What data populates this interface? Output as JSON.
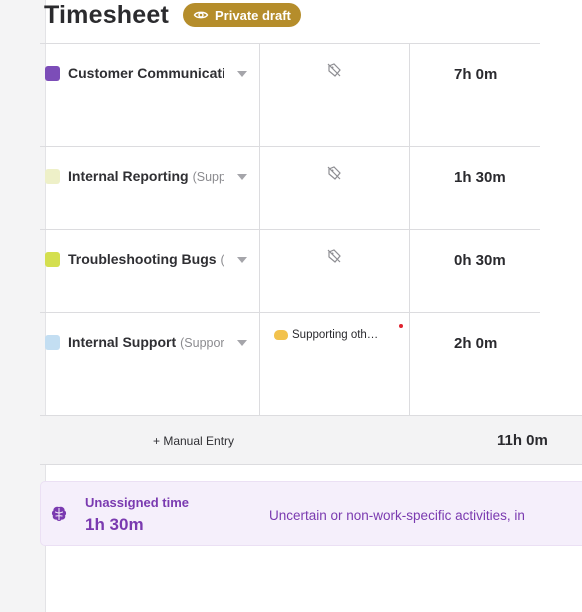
{
  "header": {
    "title": "Timesheet",
    "badge_label": "Private draft",
    "badge_icon": "eye-icon"
  },
  "rows": [
    {
      "category": "Customer Communicati",
      "subtitle": "",
      "color": "#7c4db8",
      "note": "",
      "duration": "7h 0m"
    },
    {
      "category": "Internal Reporting",
      "subtitle": "(Supp",
      "color": "#eef0c8",
      "note": "",
      "duration": "1h 30m"
    },
    {
      "category": "Troubleshooting Bugs",
      "subtitle": "(S",
      "color": "#d4df4f",
      "note": "",
      "duration": "0h 30m"
    },
    {
      "category": "Internal Support",
      "subtitle": "(Suppor",
      "color": "#c3def2",
      "note": "Supporting oth…",
      "duration": "2h 0m"
    }
  ],
  "footer": {
    "manual_entry": "+ Manual Entry",
    "total": "11h 0m"
  },
  "unassigned": {
    "label": "Unassigned time",
    "time": "1h 30m",
    "description": "Uncertain or non-work-specific activities, in",
    "icon": "brain-icon"
  }
}
